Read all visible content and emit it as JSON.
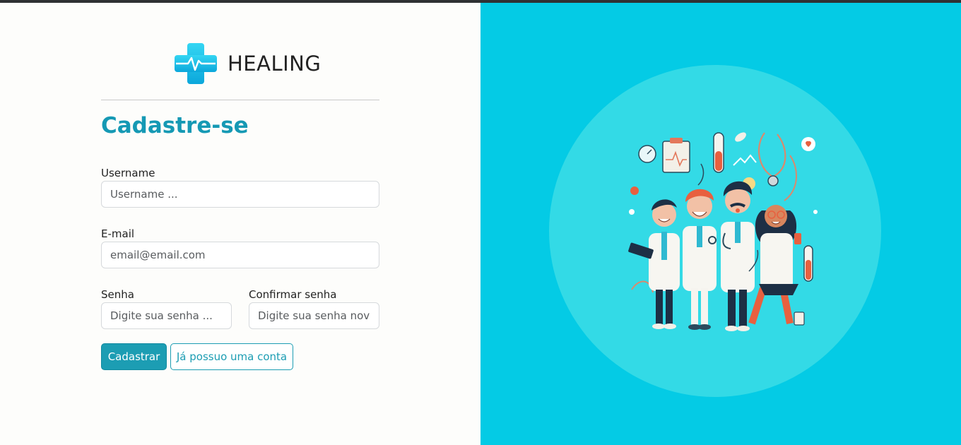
{
  "brand": {
    "name": "HEALING",
    "icon": "medical-cross-heartbeat-icon",
    "accent": "#1dc3ea"
  },
  "form": {
    "title": "Cadastre-se",
    "username": {
      "label": "Username",
      "placeholder": "Username ..."
    },
    "email": {
      "label": "E-mail",
      "placeholder": "email@email.com"
    },
    "password": {
      "label": "Senha",
      "placeholder": "Digite sua senha ..."
    },
    "confirm": {
      "label": "Confirmar senha",
      "placeholder": "Digite sua senha novamente ..."
    },
    "submit_label": "Cadastrar",
    "login_label": "Já possuo uma conta"
  },
  "illustration": {
    "subject": "group-of-doctors-illustration",
    "background": "#04cbe5",
    "circle": "#33dae6"
  }
}
